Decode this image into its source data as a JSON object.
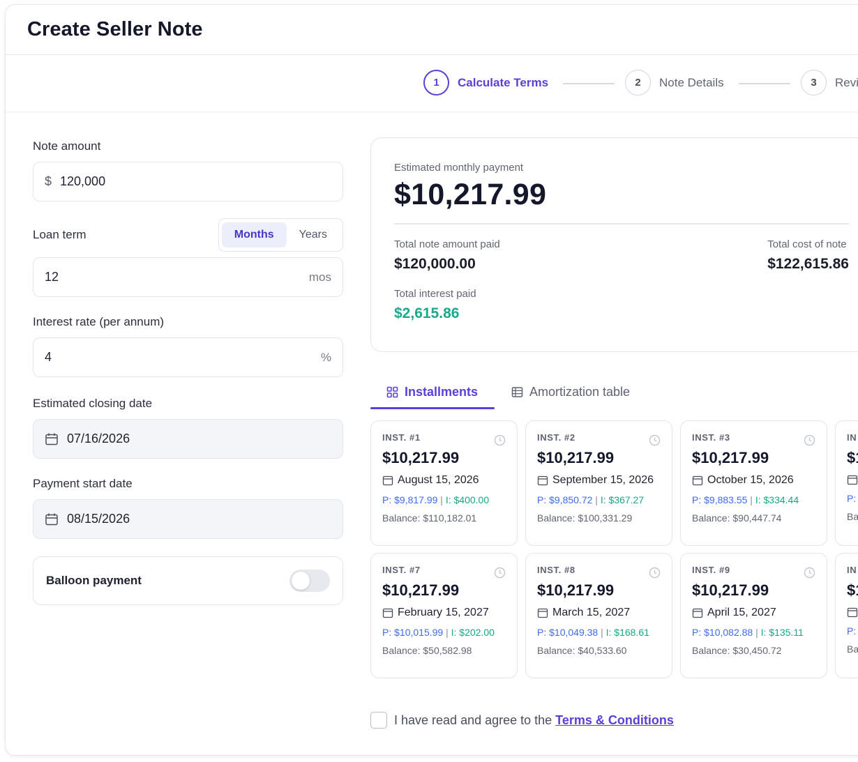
{
  "page": {
    "title": "Create Seller Note"
  },
  "stepper": [
    {
      "num": "1",
      "label": "Calculate Terms"
    },
    {
      "num": "2",
      "label": "Note Details"
    },
    {
      "num": "3",
      "label": "Revi"
    }
  ],
  "form": {
    "note_amount_label": "Note amount",
    "note_amount_prefix": "$",
    "note_amount_value": "120,000",
    "loan_term_label": "Loan term",
    "term_unit_months": "Months",
    "term_unit_years": "Years",
    "loan_term_value": "12",
    "loan_term_suffix": "mos",
    "interest_label": "Interest rate (per annum)",
    "interest_value": "4",
    "interest_suffix": "%",
    "closing_label": "Estimated closing date",
    "closing_value": "07/16/2026",
    "start_label": "Payment start date",
    "start_value": "08/15/2026",
    "balloon_label": "Balloon payment"
  },
  "summary": {
    "monthly_label": "Estimated monthly payment",
    "monthly_value": "$10,217.99",
    "total_note_label": "Total note amount paid",
    "total_note_value": "$120,000.00",
    "total_cost_label": "Total cost of note",
    "total_cost_value": "$122,615.86",
    "interest_label": "Total interest paid",
    "interest_value": "$2,615.86"
  },
  "tabs": {
    "installments": "Installments",
    "amortization": "Amortization table"
  },
  "installments": [
    {
      "tag": "INST. #1",
      "amount": "$10,217.99",
      "date": "August 15, 2026",
      "principal": "P: $9,817.99",
      "sep": " | ",
      "interest": "I: $400.00",
      "balance": "Balance: $110,182.01"
    },
    {
      "tag": "INST. #2",
      "amount": "$10,217.99",
      "date": "September 15, 2026",
      "principal": "P: $9,850.72",
      "sep": " | ",
      "interest": "I: $367.27",
      "balance": "Balance: $100,331.29"
    },
    {
      "tag": "INST. #3",
      "amount": "$10,217.99",
      "date": "October 15, 2026",
      "principal": "P: $9,883.55",
      "sep": " | ",
      "interest": "I: $334.44",
      "balance": "Balance: $90,447.74"
    },
    {
      "tag": "IN",
      "amount": "$1",
      "date": "",
      "principal": "P:",
      "sep": "",
      "interest": "",
      "balance": "Ba"
    },
    {
      "tag": "INST. #7",
      "amount": "$10,217.99",
      "date": "February 15, 2027",
      "principal": "P: $10,015.99",
      "sep": " | ",
      "interest": "I: $202.00",
      "balance": "Balance: $50,582.98"
    },
    {
      "tag": "INST. #8",
      "amount": "$10,217.99",
      "date": "March 15, 2027",
      "principal": "P: $10,049.38",
      "sep": " | ",
      "interest": "I: $168.61",
      "balance": "Balance: $40,533.60"
    },
    {
      "tag": "INST. #9",
      "amount": "$10,217.99",
      "date": "April 15, 2027",
      "principal": "P: $10,082.88",
      "sep": " | ",
      "interest": "I: $135.11",
      "balance": "Balance: $30,450.72"
    },
    {
      "tag": "IN",
      "amount": "$1",
      "date": "",
      "principal": "P:",
      "sep": "",
      "interest": "",
      "balance": "Ba"
    }
  ],
  "agree": {
    "text": "I have read and agree to the",
    "link": "Terms & Conditions"
  }
}
